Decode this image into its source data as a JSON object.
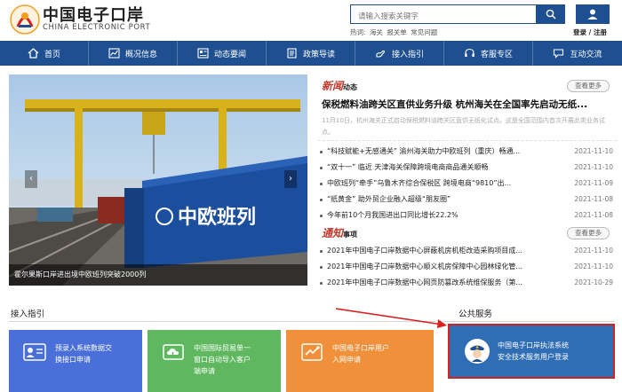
{
  "header": {
    "logo_cn": "中国电子口岸",
    "logo_en": "CHINA ELECTRONIC PORT",
    "search_placeholder": "请输入搜索关键字",
    "hot_label": "热词:",
    "hot_words": [
      "海关",
      "报关单",
      "常见问题"
    ],
    "login_text": "登录 / 注册"
  },
  "nav": {
    "items": [
      {
        "label": "首页",
        "icon": "home-icon"
      },
      {
        "label": "概况信息",
        "icon": "chart-icon"
      },
      {
        "label": "动态要闻",
        "icon": "news-icon"
      },
      {
        "label": "政策导读",
        "icon": "document-icon"
      },
      {
        "label": "接入指引",
        "icon": "hand-icon"
      },
      {
        "label": "客服专区",
        "icon": "headset-icon"
      },
      {
        "label": "互动交流",
        "icon": "chat-icon"
      }
    ]
  },
  "hero": {
    "caption": "霍尔果斯口岸进出境中欧班列突破2000列",
    "container_text": "中欧班列"
  },
  "news": {
    "title_main": "新闻",
    "title_sub": "动态",
    "more": "查看更多",
    "headline": "保税燃料油跨关区直供业务升级 杭州海关在全国率先启动无纸...",
    "summary": "11月10日，杭州海关正式启动保税燃料油跨关区直供无纸化试点。这是全国范围内首次开展此类业务试点。",
    "items": [
      {
        "text": "“科技赋能+无感通关” 渝州海关助力中欧班列（重庆）畅通...",
        "date": "2021-11-10"
      },
      {
        "text": "“双十一” 临近 天津海关保障跨境电商商品通关顺畅",
        "date": "2021-11-10"
      },
      {
        "text": "中欧班列“牵手”乌鲁木齐综合保税区 跨境电商“9810”出...",
        "date": "2021-11-09"
      },
      {
        "text": "“纸黄金” 助外贸企业融入超级“朋友圈”",
        "date": "2021-11-08"
      },
      {
        "text": "今年前10个月我国进出口同比增长22.2%",
        "date": "2021-11-08"
      }
    ]
  },
  "notice": {
    "title_main": "通知",
    "title_sub": "事项",
    "more": "查看更多",
    "items": [
      {
        "text": "2021年中国电子口岸数据中心屏蔽机房机柜改造采购项目成...",
        "date": "2021-11-10"
      },
      {
        "text": "2021年中国电子口岸数据中心顺义机房保障中心园林绿化管...",
        "date": "2021-11-10"
      },
      {
        "text": "2021年中国电子口岸数据中心网页防篡改系统维保服务（第...",
        "date": "2021-10-29"
      }
    ]
  },
  "access": {
    "title": "接入指引",
    "cards": [
      {
        "label_lines": [
          "预录入系统数据交",
          "换接口申请"
        ],
        "color": "#4a6fd8",
        "icon": "id-card-icon"
      },
      {
        "label_lines": [
          "中国国际贸易单一",
          "窗口自动导入客户",
          "端申请"
        ],
        "color": "#5fb85f",
        "icon": "cloud-upload-icon"
      },
      {
        "label_lines": [
          "中国电子口岸用户",
          "入网申请"
        ],
        "color": "#f0903a",
        "icon": "network-icon"
      }
    ]
  },
  "public_service": {
    "title": "公共服务",
    "label_lines": [
      "中国电子口岸执法系统",
      "安全技术服务用户登录"
    ],
    "icon": "police-icon"
  },
  "colors": {
    "brand_blue": "#1d4f91",
    "accent_red": "#d8201e"
  }
}
